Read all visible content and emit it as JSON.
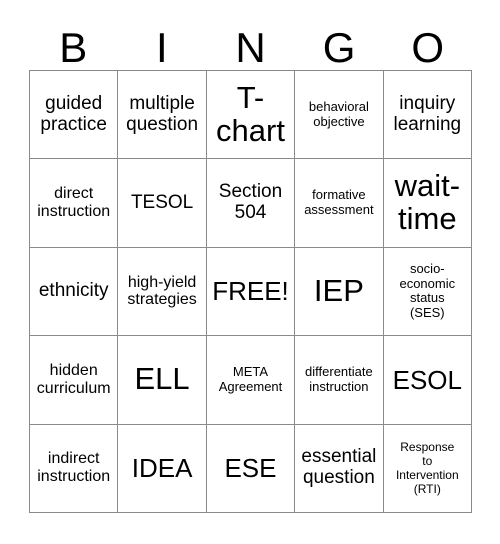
{
  "card": {
    "title": "Bingo Card",
    "header_letters": [
      "B",
      "I",
      "N",
      "G",
      "O"
    ],
    "rows": [
      [
        {
          "text": "guided\npractice",
          "size": "sz-md"
        },
        {
          "text": "multiple\nquestion",
          "size": "sz-md"
        },
        {
          "text": "T-\nchart",
          "size": "sz-xl"
        },
        {
          "text": "behavioral\nobjective",
          "size": "sz-xs"
        },
        {
          "text": "inquiry\nlearning",
          "size": "sz-md"
        }
      ],
      [
        {
          "text": "direct\ninstruction",
          "size": "sz-sm"
        },
        {
          "text": "TESOL",
          "size": "sz-md"
        },
        {
          "text": "Section\n504",
          "size": "sz-md"
        },
        {
          "text": "formative\nassessment",
          "size": "sz-xs"
        },
        {
          "text": "wait-\ntime",
          "size": "sz-xl"
        }
      ],
      [
        {
          "text": "ethnicity",
          "size": "sz-md"
        },
        {
          "text": "high-yield\nstrategies",
          "size": "sz-sm"
        },
        {
          "text": "FREE!",
          "size": "sz-lg"
        },
        {
          "text": "IEP",
          "size": "sz-xl"
        },
        {
          "text": "socio-\neconomic\nstatus\n(SES)",
          "size": "sz-xs"
        }
      ],
      [
        {
          "text": "hidden\ncurriculum",
          "size": "sz-sm"
        },
        {
          "text": "ELL",
          "size": "sz-xl"
        },
        {
          "text": "META\nAgreement",
          "size": "sz-xs"
        },
        {
          "text": "differentiate\ninstruction",
          "size": "sz-xs"
        },
        {
          "text": "ESOL",
          "size": "sz-lg"
        }
      ],
      [
        {
          "text": "indirect\ninstruction",
          "size": "sz-sm"
        },
        {
          "text": "IDEA",
          "size": "sz-lg"
        },
        {
          "text": "ESE",
          "size": "sz-lg"
        },
        {
          "text": "essential\nquestion",
          "size": "sz-md"
        },
        {
          "text": "Response\nto\nIntervention\n(RTI)",
          "size": "sz-xxs"
        }
      ]
    ],
    "free_space": "FREE!",
    "colors": {
      "background": "#ffffff",
      "text": "#000000",
      "grid_line": "#8a8a8a"
    }
  }
}
